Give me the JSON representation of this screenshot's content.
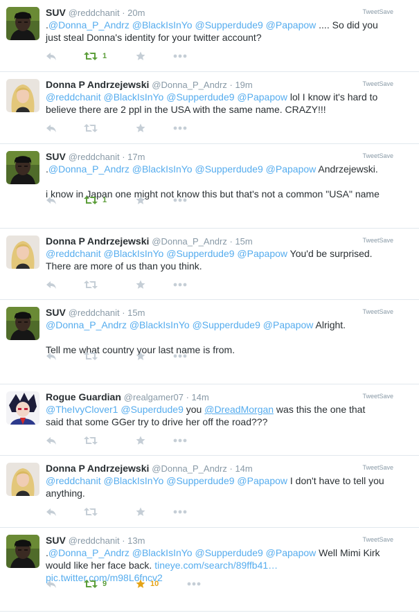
{
  "tweetsave_label": "TweetSave",
  "tweets": [
    {
      "avatar": "suv",
      "name": "SUV",
      "handle": "@reddchanit",
      "time": "20m",
      "lines": [
        [
          {
            "t": "."
          },
          {
            "t": "@Donna_P_Andrz",
            "c": "m"
          },
          {
            "t": " "
          },
          {
            "t": "@BlackIsInYo",
            "c": "m"
          },
          {
            "t": " "
          },
          {
            "t": "@Supperdude9",
            "c": "m"
          },
          {
            "t": " "
          },
          {
            "t": "@Papapow",
            "c": "m"
          },
          {
            "t": " .... So did you"
          }
        ],
        [
          {
            "t": "just steal Donna's identity for your twitter account?"
          }
        ]
      ],
      "retweets": "1",
      "favorites": ""
    },
    {
      "avatar": "donna",
      "name": "Donna P Andrzejewski",
      "handle": "@Donna_P_Andrz",
      "time": "19m",
      "lines": [
        [
          {
            "t": "@reddchanit",
            "c": "m"
          },
          {
            "t": " "
          },
          {
            "t": "@BlackIsInYo",
            "c": "m"
          },
          {
            "t": " "
          },
          {
            "t": "@Supperdude9",
            "c": "m"
          },
          {
            "t": " "
          },
          {
            "t": "@Papapow",
            "c": "m"
          },
          {
            "t": " lol I know it's hard to"
          }
        ],
        [
          {
            "t": "believe there are 2 ppl in the USA with the same name. CRAZY!!!"
          }
        ]
      ],
      "retweets": "",
      "favorites": ""
    },
    {
      "avatar": "suv",
      "name": "SUV",
      "handle": "@reddchanit",
      "time": "17m",
      "lines": [
        [
          {
            "t": "."
          },
          {
            "t": "@Donna_P_Andrz",
            "c": "m"
          },
          {
            "t": " "
          },
          {
            "t": "@BlackIsInYo",
            "c": "m"
          },
          {
            "t": " "
          },
          {
            "t": "@Supperdude9",
            "c": "m"
          },
          {
            "t": " "
          },
          {
            "t": "@Papapow",
            "c": "m"
          },
          {
            "t": " Andrzejewski."
          }
        ],
        [
          {
            "t": "i know in Japan one might not know this but that's not a common \"USA\" name",
            "gap": true
          }
        ]
      ],
      "retweets": "1",
      "favorites": ""
    },
    {
      "avatar": "donna",
      "name": "Donna P Andrzejewski",
      "handle": "@Donna_P_Andrz",
      "time": "15m",
      "lines": [
        [
          {
            "t": "@reddchanit",
            "c": "m"
          },
          {
            "t": " "
          },
          {
            "t": "@BlackIsInYo",
            "c": "m"
          },
          {
            "t": " "
          },
          {
            "t": "@Supperdude9",
            "c": "m"
          },
          {
            "t": " "
          },
          {
            "t": "@Papapow",
            "c": "m"
          },
          {
            "t": " You'd be surprised."
          }
        ],
        [
          {
            "t": "There are more of us than you think."
          }
        ]
      ],
      "retweets": "",
      "favorites": ""
    },
    {
      "avatar": "suv",
      "name": "SUV",
      "handle": "@reddchanit",
      "time": "15m",
      "lines": [
        [
          {
            "t": "@Donna_P_Andrz",
            "c": "m"
          },
          {
            "t": " "
          },
          {
            "t": "@BlackIsInYo",
            "c": "m"
          },
          {
            "t": " "
          },
          {
            "t": "@Supperdude9",
            "c": "m"
          },
          {
            "t": " "
          },
          {
            "t": "@Papapow",
            "c": "m"
          },
          {
            "t": " Alright."
          }
        ],
        [
          {
            "t": "Tell me what country your last name is from.",
            "gap": true
          }
        ]
      ],
      "retweets": "",
      "favorites": ""
    },
    {
      "avatar": "rogue",
      "name": "Rogue Guardian",
      "handle": "@realgamer07",
      "time": "14m",
      "lines": [
        [
          {
            "t": "@TheIvyClover1",
            "c": "m"
          },
          {
            "t": " "
          },
          {
            "t": "@Superdude9",
            "c": "m"
          },
          {
            "t": " you "
          },
          {
            "t": "@DreadMorgan",
            "c": "mu"
          },
          {
            "t": " was this the one that"
          }
        ],
        [
          {
            "t": "said that some GGer try to drive her off the road???"
          }
        ]
      ],
      "retweets": "",
      "favorites": ""
    },
    {
      "avatar": "donna",
      "name": "Donna P Andrzejewski",
      "handle": "@Donna_P_Andrz",
      "time": "14m",
      "lines": [
        [
          {
            "t": "@reddchanit",
            "c": "m"
          },
          {
            "t": " "
          },
          {
            "t": "@BlackIsInYo",
            "c": "m"
          },
          {
            "t": " "
          },
          {
            "t": "@Supperdude9",
            "c": "m"
          },
          {
            "t": " "
          },
          {
            "t": "@Papapow",
            "c": "m"
          },
          {
            "t": " I don't have to tell you"
          }
        ],
        [
          {
            "t": "anything."
          }
        ]
      ],
      "retweets": "",
      "favorites": ""
    },
    {
      "avatar": "suv",
      "name": "SUV",
      "handle": "@reddchanit",
      "time": "13m",
      "lines": [
        [
          {
            "t": "."
          },
          {
            "t": "@Donna_P_Andrz",
            "c": "m"
          },
          {
            "t": " "
          },
          {
            "t": "@BlackIsInYo",
            "c": "m"
          },
          {
            "t": " "
          },
          {
            "t": "@Supperdude9",
            "c": "m"
          },
          {
            "t": " "
          },
          {
            "t": "@Papapow",
            "c": "m"
          },
          {
            "t": " Well Mimi Kirk"
          }
        ],
        [
          {
            "t": "would like her face back. "
          },
          {
            "t": "tineye.com/search/89ffb41…",
            "c": "l"
          }
        ],
        [
          {
            "t": "pic.twitter.com/m98L6fncv2",
            "c": "l"
          }
        ]
      ],
      "retweets": "9",
      "favorites": "10"
    }
  ],
  "colors": {
    "text": "#292f33",
    "muted": "#8899a6",
    "link": "#55acee",
    "retweet_active": "#5c9e3a",
    "favorite_active": "#e5a316",
    "icon_inactive": "#c5ced6",
    "divider": "#e1e8ed"
  },
  "icons": [
    "reply-icon",
    "retweet-icon",
    "favorite-icon",
    "more-icon"
  ]
}
